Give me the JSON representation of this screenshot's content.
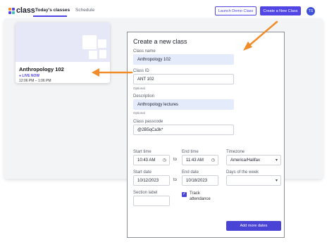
{
  "colors": {
    "accent": "#5146e5",
    "arrow": "#f28c28",
    "thumb_bg": "#e7e8f7",
    "filled_field": "#e4ebfb"
  },
  "header": {
    "logo_text": "class",
    "tabs": [
      {
        "label": "Today's classes",
        "active": true
      },
      {
        "label": "Schedule",
        "active": false
      }
    ],
    "launch_demo_label": "Launch Demo Class",
    "create_label": "Create a New Class",
    "avatar_initials": "TS"
  },
  "class_card": {
    "title": "Anthropology 102",
    "live_label": "LIVE NOW",
    "time": "12:06 PM – 1:06 PM"
  },
  "dialog": {
    "title": "Create a new class",
    "class_name": {
      "label": "Class name",
      "value": "Anthropology 102"
    },
    "class_id": {
      "label": "Class ID",
      "value": "ANT 102",
      "hint": "Optional"
    },
    "description": {
      "label": "Description",
      "value": "Anthropology lectures",
      "hint": "Optional"
    },
    "passcode": {
      "label": "Class passcode",
      "value": "@2B5qCa3k*"
    },
    "start_time": {
      "label": "Start time",
      "value": "10:43 AM",
      "icon": "clock-icon"
    },
    "end_time": {
      "label": "End time",
      "value": "11:43 AM",
      "icon": "clock-icon"
    },
    "to_label": "to",
    "timezone": {
      "label": "Timezone",
      "value": "America/Halifax",
      "icon": "dropdown-caret-icon"
    },
    "start_date": {
      "label": "Start date",
      "value": "10/12/2023"
    },
    "end_date": {
      "label": "End date",
      "value": "10/18/2023"
    },
    "days_of_week": {
      "label": "Days of the week",
      "value": "",
      "icon": "dropdown-caret-icon"
    },
    "section_label": {
      "label": "Section label",
      "value": ""
    },
    "track_attendance": {
      "label": "Track attendance",
      "checked": true
    },
    "add_more_dates_label": "Add more dates"
  }
}
